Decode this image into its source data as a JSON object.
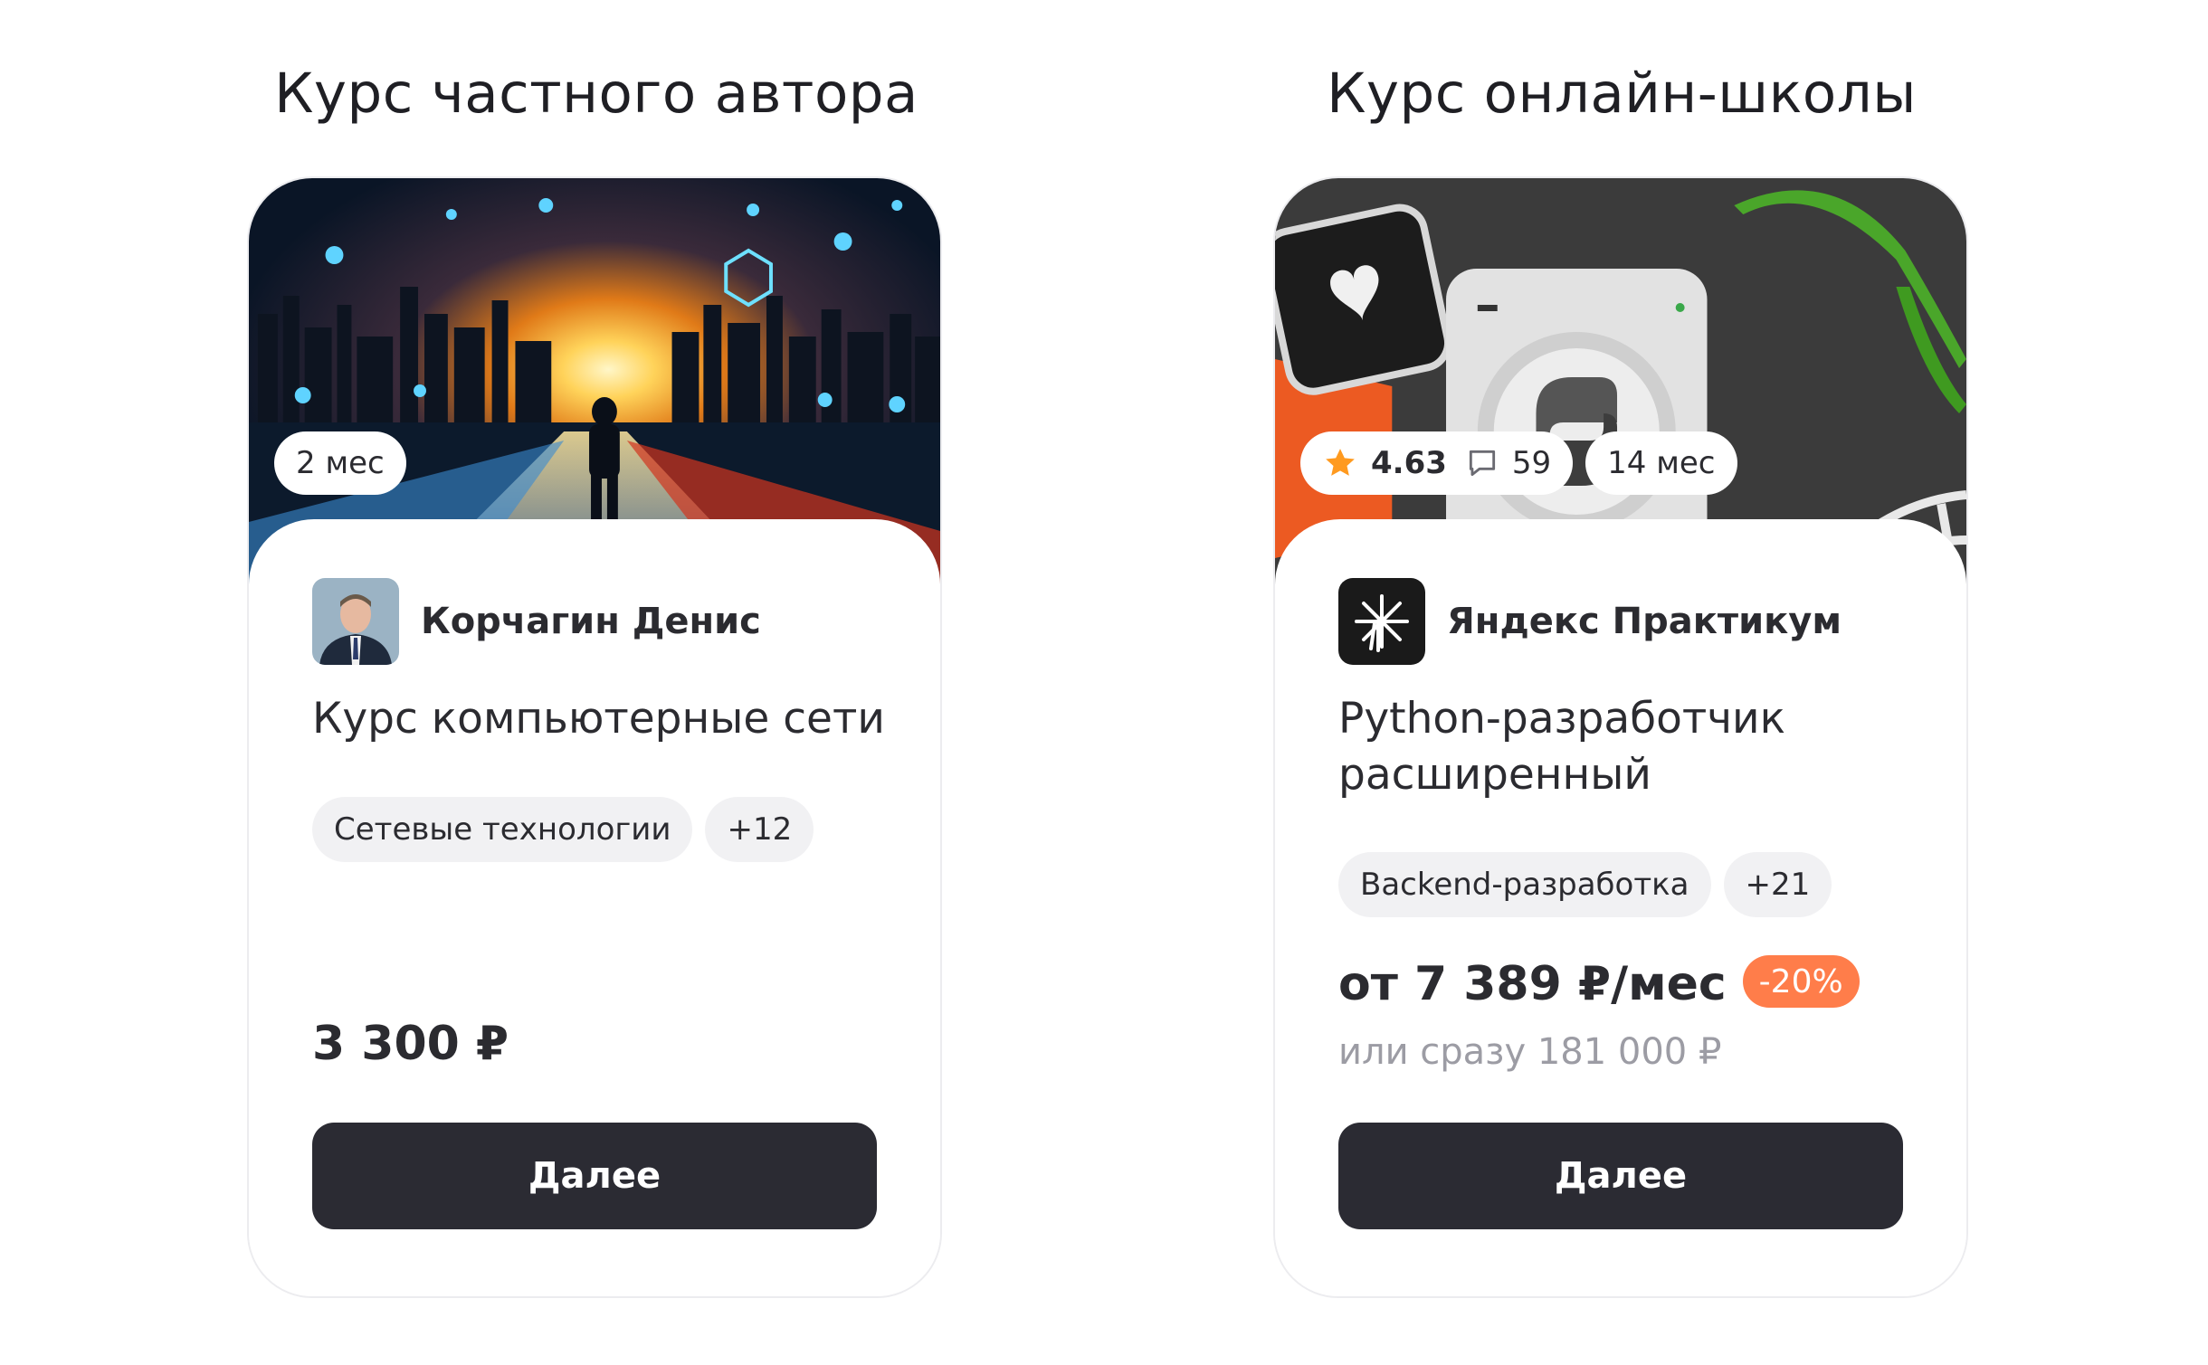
{
  "headings": {
    "private_author": "Курс частного автора",
    "online_school": "Курс онлайн-школы"
  },
  "cards": [
    {
      "duration": "2 мес",
      "author_name": "Корчагин Денис",
      "title": "Курс компьютерные сети",
      "tag_main": "Сетевые технологии",
      "tag_more": "+12",
      "price": "3 300 ₽",
      "button_label": "Далее"
    },
    {
      "rating": "4.63",
      "reviews": "59",
      "duration": "14 мес",
      "author_name": "Яндекс Практикум",
      "title": "Python-разработчик расширенный",
      "tag_main": "Backend-разработка",
      "tag_more": "+21",
      "price_monthly": "от 7 389 ₽/мес",
      "discount": "-20%",
      "price_full": "или сразу 181 000 ₽",
      "button_label": "Далее"
    }
  ],
  "icons": {
    "star": "star-icon",
    "comment": "comment-icon",
    "heart": "heart-icon",
    "python": "python-logo-icon",
    "practicum_logo": "practicum-logo-icon"
  },
  "colors": {
    "button_bg": "#2b2b33",
    "discount_bg": "#ff7d4a",
    "star": "#ff9a1f",
    "tag_bg": "#f1f1f3"
  }
}
